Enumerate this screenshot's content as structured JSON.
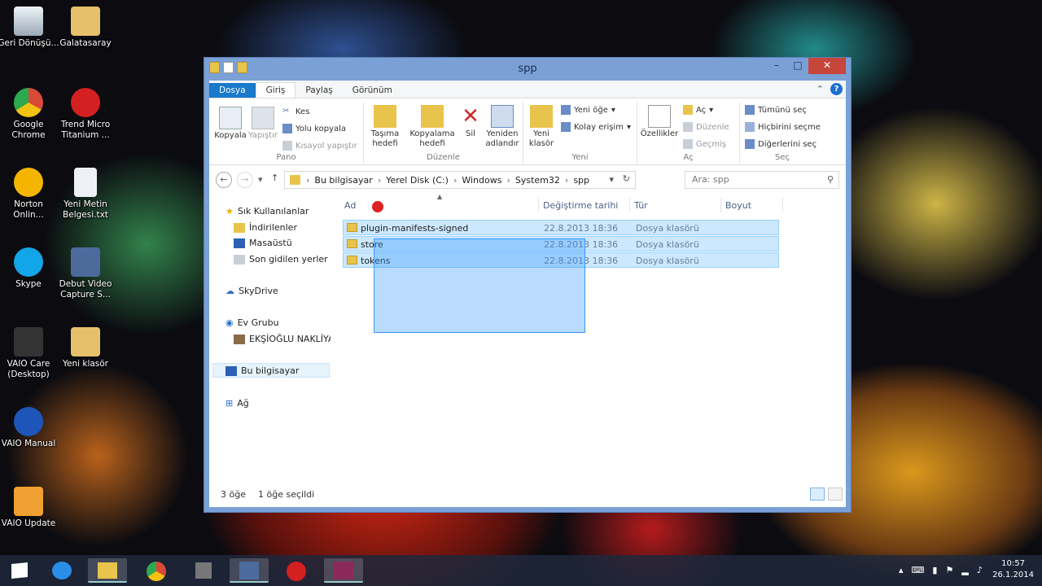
{
  "desktop_icons": [
    {
      "label": "Geri Dönüşü...",
      "icon": "recycle-bin-icon",
      "color": "#c9d3de"
    },
    {
      "label": "Galatasaray",
      "icon": "folder-icon",
      "color": "#e6c06a"
    },
    {
      "label": "Google Chrome",
      "icon": "chrome-icon",
      "color": "#d84a38"
    },
    {
      "label": "Trend Micro Titanium ...",
      "icon": "trend-micro-icon",
      "color": "#d42020"
    },
    {
      "label": "Norton Onlin...",
      "icon": "norton-icon",
      "color": "#f4b400"
    },
    {
      "label": "Yeni Metin Belgesi.txt",
      "icon": "text-file-icon",
      "color": "#eef2f6"
    },
    {
      "label": "Skype",
      "icon": "skype-icon",
      "color": "#12a5e8"
    },
    {
      "label": "Debut Video Capture S...",
      "icon": "film-icon",
      "color": "#4c6b9c"
    },
    {
      "label": "VAIO Care (Desktop)",
      "icon": "vaio-care-icon",
      "color": "#333333"
    },
    {
      "label": "Yeni klasör",
      "icon": "folder-icon",
      "color": "#e6c06a"
    },
    {
      "label": "VAIO Manual",
      "icon": "help-icon",
      "color": "#1d56b8"
    },
    {
      "label": "VAIO Update",
      "icon": "update-icon",
      "color": "#f0a030"
    }
  ],
  "window": {
    "title": "spp",
    "controls": {
      "minimize": "–",
      "maximize": "□",
      "close": "✕"
    },
    "tabs": [
      "Dosya",
      "Giriş",
      "Paylaş",
      "Görünüm"
    ],
    "help": "?",
    "ribbon": {
      "pano": {
        "label": "Pano",
        "copy": "Kopyala",
        "paste": "Yapıştır",
        "cut": "Kes",
        "copy_path": "Yolu kopyala",
        "paste_shortcut": "Kısayol yapıştır"
      },
      "duzenle": {
        "label": "Düzenle",
        "move_to": "Taşıma hedefi",
        "copy_to": "Kopyalama hedefi",
        "delete": "Sil",
        "rename": "Yeniden adlandır"
      },
      "yeni": {
        "label": "Yeni",
        "new_folder": "Yeni klasör",
        "new_item": "Yeni öğe",
        "easy_access": "Kolay erişim"
      },
      "ac": {
        "label": "Aç",
        "properties": "Özellikler",
        "open": "Aç",
        "edit": "Düzenle",
        "history": "Geçmiş"
      },
      "sec": {
        "label": "Seç",
        "select_all": "Tümünü seç",
        "select_none": "Hiçbirini seçme",
        "invert": "Diğerlerini seç"
      }
    },
    "address": {
      "crumbs": [
        "Bu bilgisayar",
        "Yerel Disk (C:)",
        "Windows",
        "System32",
        "spp"
      ],
      "search_placeholder": "Ara: spp"
    },
    "nav": {
      "favorites": "Sık Kullanılanlar",
      "downloads": "İndirilenler",
      "desktop": "Masaüstü",
      "recent": "Son gidilen yerler",
      "skydrive": "SkyDrive",
      "homegroup": "Ev Grubu",
      "homegroup_user": "EKŞİOĞLU NAKLİYAT",
      "this_pc": "Bu bilgisayar",
      "network": "Ağ"
    },
    "columns": {
      "name": "Ad",
      "modified": "Değiştirme tarihi",
      "type": "Tür",
      "size": "Boyut"
    },
    "files": [
      {
        "name": "plugin-manifests-signed",
        "date": "22.8.2013 18:36",
        "type": "Dosya klasörü"
      },
      {
        "name": "store",
        "date": "22.8.2013 18:36",
        "type": "Dosya klasörü"
      },
      {
        "name": "tokens",
        "date": "22.8.2013 18:36",
        "type": "Dosya klasörü"
      }
    ],
    "status": {
      "count": "3 öğe",
      "selected": "1 öğe seçildi"
    }
  },
  "taskbar": {
    "apps": [
      "windows-start-icon",
      "internet-explorer-icon",
      "file-explorer-icon",
      "chrome-icon",
      "tools-icon",
      "film-icon",
      "trend-micro-icon",
      "winrar-icon"
    ],
    "time": "10:57",
    "date": "26.1.2014"
  }
}
